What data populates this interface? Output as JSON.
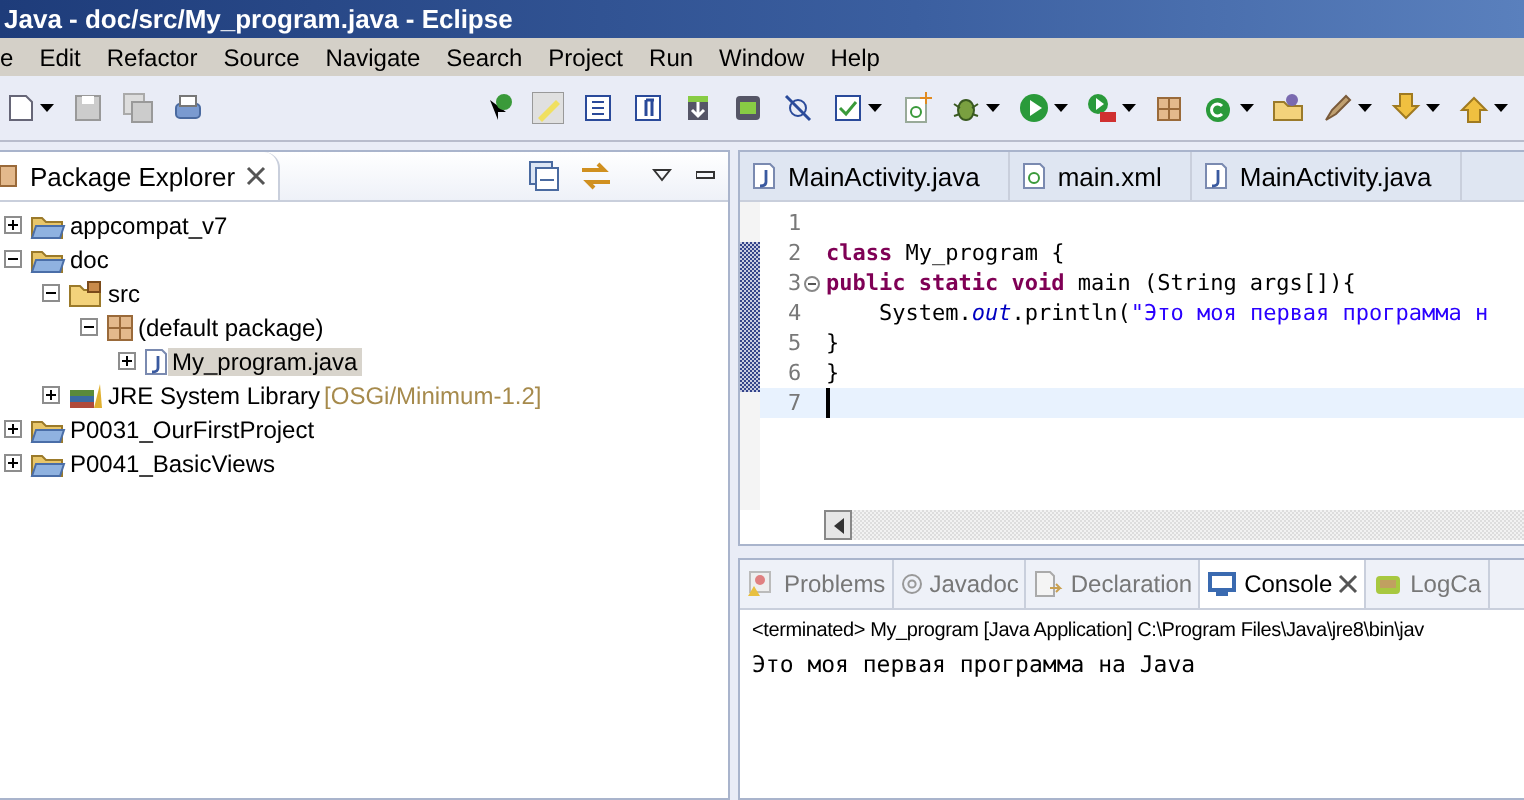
{
  "window": {
    "title": "Java - doc/src/My_program.java - Eclipse"
  },
  "menu": [
    "e",
    "Edit",
    "Refactor",
    "Source",
    "Navigate",
    "Search",
    "Project",
    "Run",
    "Window",
    "Help"
  ],
  "package_explorer": {
    "title": "Package Explorer",
    "items": [
      {
        "label": "appcompat_v7",
        "kind": "project",
        "expanded": false,
        "selected": false
      },
      {
        "label": "doc",
        "kind": "project",
        "expanded": true,
        "selected": false,
        "children": [
          {
            "label": "src",
            "kind": "folder",
            "expanded": true,
            "selected": false,
            "children": [
              {
                "label": "(default package)",
                "kind": "package",
                "expanded": true,
                "selected": false,
                "children": [
                  {
                    "label": "My_program.java",
                    "kind": "file",
                    "expanded": false,
                    "selected": true
                  }
                ]
              }
            ]
          },
          {
            "label": "JRE System Library",
            "decoration": "[OSGi/Minimum-1.2]",
            "kind": "library",
            "expanded": false,
            "selected": false
          }
        ]
      },
      {
        "label": "P0031_OurFirstProject",
        "kind": "project",
        "expanded": false,
        "selected": false
      },
      {
        "label": "P0041_BasicViews",
        "kind": "project",
        "expanded": false,
        "selected": false
      }
    ]
  },
  "editor": {
    "tabs": [
      {
        "label": "MainActivity.java",
        "kind": "java",
        "selected": false
      },
      {
        "label": "main.xml",
        "kind": "xml",
        "selected": false
      },
      {
        "label": "MainActivity.java",
        "kind": "java",
        "selected": false
      }
    ],
    "lines": [
      {
        "number": "1",
        "foldable": false,
        "current": false
      },
      {
        "number": "2",
        "foldable": false,
        "current": false,
        "tokens": [
          {
            "kind": "keyword",
            "text": "class"
          },
          {
            "kind": "plain",
            "text": " My_program {"
          }
        ]
      },
      {
        "number": "3",
        "foldable": true,
        "current": false,
        "tokens": [
          {
            "kind": "keyword",
            "text": "public static void"
          },
          {
            "kind": "plain",
            "text": " main (String args[]){"
          }
        ]
      },
      {
        "number": "4",
        "foldable": false,
        "current": false,
        "tokens": [
          {
            "kind": "plain",
            "text": "    System."
          },
          {
            "kind": "field",
            "text": "out"
          },
          {
            "kind": "plain",
            "text": ".println("
          },
          {
            "kind": "string",
            "text": "\"Это моя первая программа н"
          }
        ]
      },
      {
        "number": "5",
        "foldable": false,
        "current": false,
        "tokens": [
          {
            "kind": "plain",
            "text": "}"
          }
        ]
      },
      {
        "number": "6",
        "foldable": false,
        "current": false,
        "tokens": [
          {
            "kind": "plain",
            "text": "}"
          }
        ]
      },
      {
        "number": "7",
        "foldable": false,
        "current": true
      }
    ]
  },
  "bottom_panel": {
    "tabs": [
      {
        "label": "Problems",
        "kind": "problems",
        "selected": false
      },
      {
        "label": "Javadoc",
        "kind": "javadoc",
        "selected": false
      },
      {
        "label": "Declaration",
        "kind": "declaration",
        "selected": false
      },
      {
        "label": "Console",
        "kind": "console",
        "selected": true
      },
      {
        "label": "LogCa",
        "kind": "logcat",
        "selected": false
      }
    ],
    "console_header": "<terminated> My_program [Java Application] C:\\Program Files\\Java\\jre8\\bin\\jav",
    "output": "Это моя первая программа на Java"
  }
}
